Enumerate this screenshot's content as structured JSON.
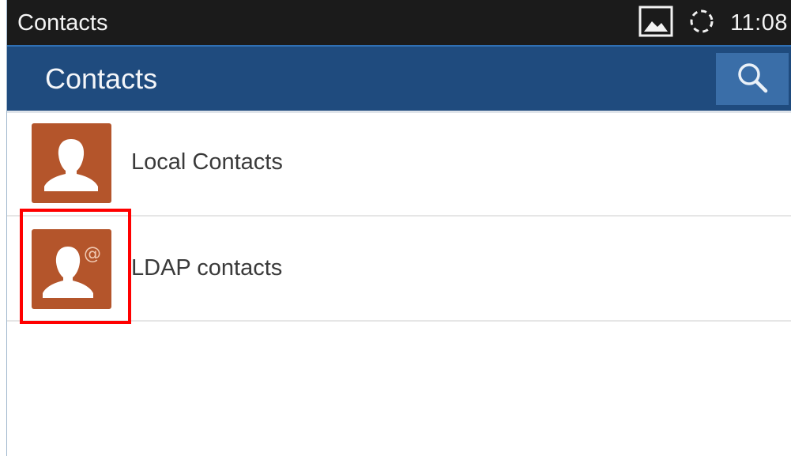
{
  "status_bar": {
    "title": "Contacts",
    "time": "11:08",
    "icons": [
      "image-icon",
      "sync-icon"
    ]
  },
  "action_bar": {
    "title": "Contacts",
    "search_icon": "search-icon"
  },
  "contacts_list": {
    "items": [
      {
        "label": "Local Contacts",
        "icon": "person-icon"
      },
      {
        "label": "LDAP contacts",
        "icon": "person-at-icon"
      }
    ]
  },
  "colors": {
    "status_bar_bg": "#1b1b1b",
    "action_bar_bg": "#1f4b7e",
    "search_button_bg": "#3a6ea8",
    "avatar_bg": "#b4552b",
    "highlight": "#ff0000"
  }
}
